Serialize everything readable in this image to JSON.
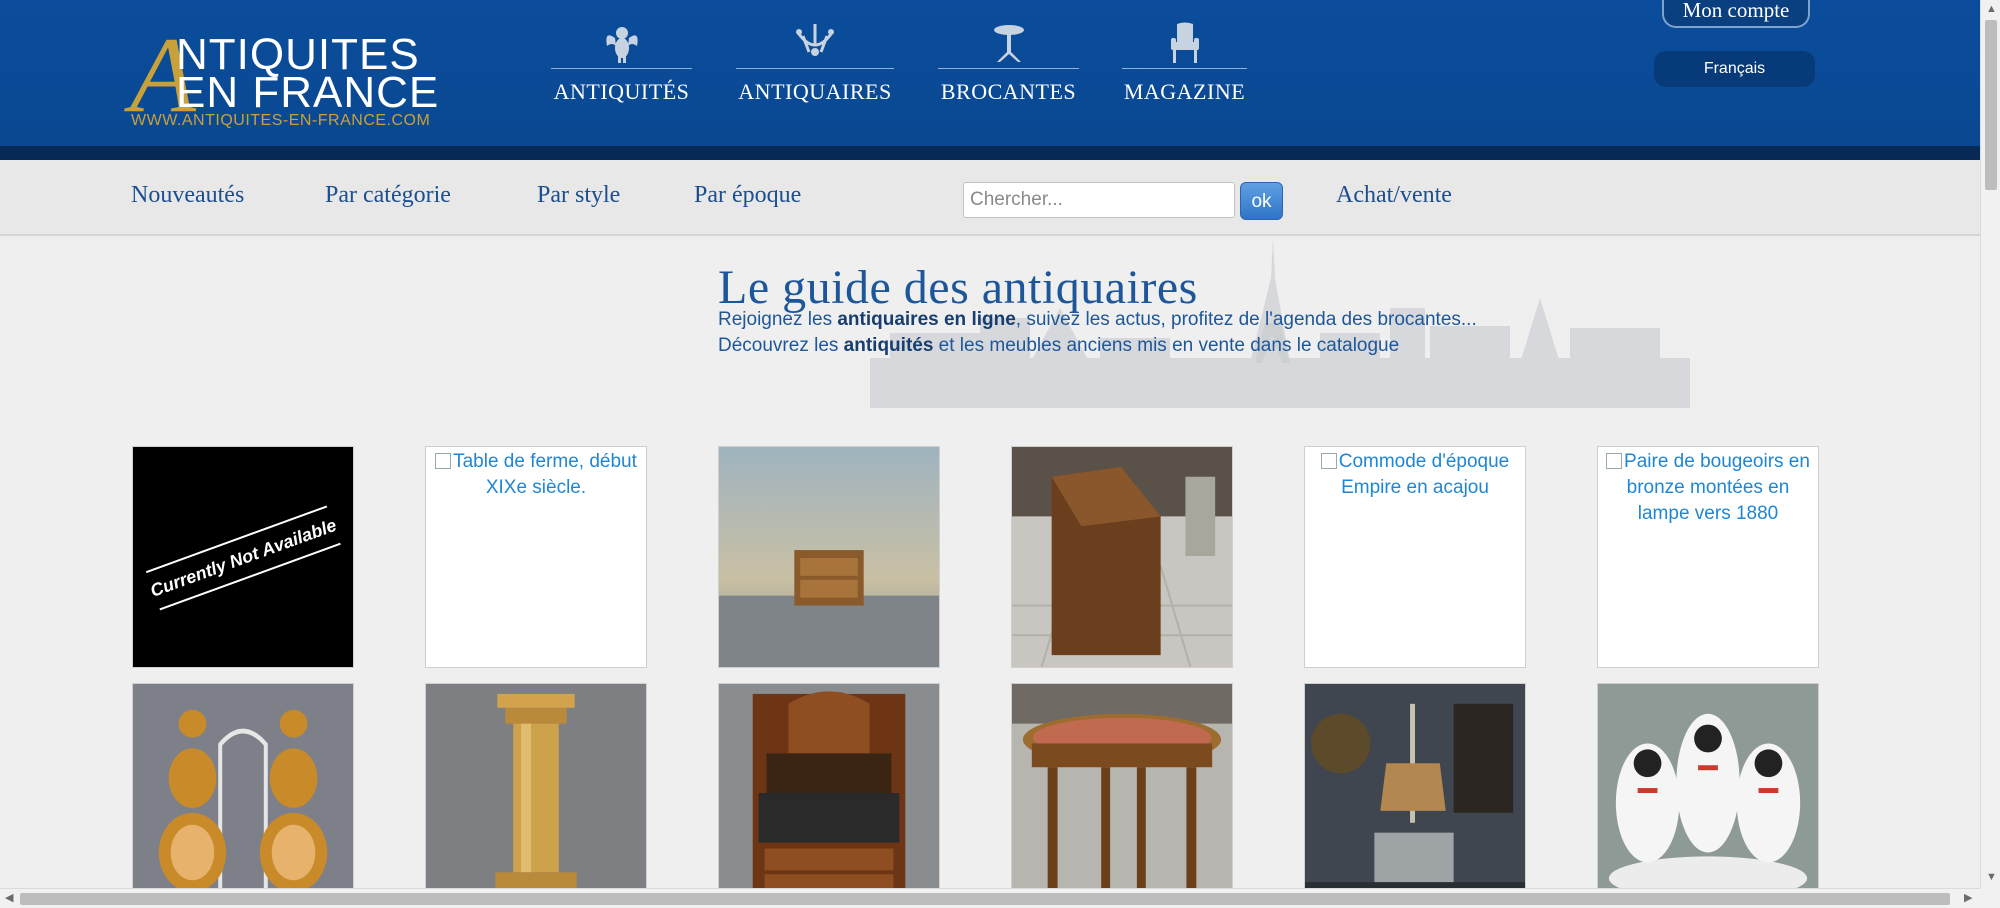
{
  "header": {
    "logo": {
      "line1": "NTIQUITES",
      "line2": "EN FRANCE",
      "letter": "A",
      "url": "WWW.ANTIQUITES-EN-FRANCE.COM"
    },
    "nav": [
      {
        "label": "ANTIQUITÉS",
        "icon": "cherub-icon"
      },
      {
        "label": "ANTIQUAIRES",
        "icon": "chandelier-icon"
      },
      {
        "label": "BROCANTES",
        "icon": "gueridon-icon"
      },
      {
        "label": "MAGAZINE",
        "icon": "armchair-icon"
      }
    ],
    "account_label": "Mon compte",
    "language_label": "Français"
  },
  "subnav": {
    "links": [
      "Nouveautés",
      "Par catégorie",
      "Par style",
      "Par époque"
    ],
    "search_placeholder": "Chercher...",
    "search_button": "ok",
    "achat_label": "Achat/vente"
  },
  "intro": {
    "title": "Le guide des antiquaires",
    "line1_a": "Rejoignez les ",
    "line1_b": "antiquaires en ligne",
    "line1_c": ", suivez les actus, profitez de l'agenda des brocantes...",
    "line2_a": "Découvrez les ",
    "line2_b": "antiquités",
    "line2_c": " et les meubles anciens mis en vente dans le catalogue"
  },
  "tiles": {
    "row1": [
      {
        "kind": "image",
        "icon": "currently-not-available-image",
        "caption": "Currently Not Available"
      },
      {
        "kind": "broken",
        "alt": "Table de ferme, début XIXe siècle."
      },
      {
        "kind": "image",
        "icon": "small-commode-photo"
      },
      {
        "kind": "image",
        "icon": "secretary-desk-photo"
      },
      {
        "kind": "broken",
        "alt": "Commode d'époque Empire en acajou"
      },
      {
        "kind": "broken",
        "alt": "Paire de bougeoirs en bronze montées en lampe vers 1880"
      }
    ],
    "row2": [
      {
        "kind": "image",
        "icon": "cameo-earrings-photo"
      },
      {
        "kind": "image",
        "icon": "marble-column-photo"
      },
      {
        "kind": "image",
        "icon": "secretaire-photo"
      },
      {
        "kind": "image",
        "icon": "round-table-photo"
      },
      {
        "kind": "image",
        "icon": "bouillotte-lamp-photo"
      },
      {
        "kind": "image",
        "icon": "porcelain-dogs-photo"
      }
    ]
  },
  "colors": {
    "header_blue": "#0b4d9c",
    "gold": "#c9a13a",
    "link_blue": "#1b4f8f",
    "alt_text_blue": "#1f86d6"
  }
}
